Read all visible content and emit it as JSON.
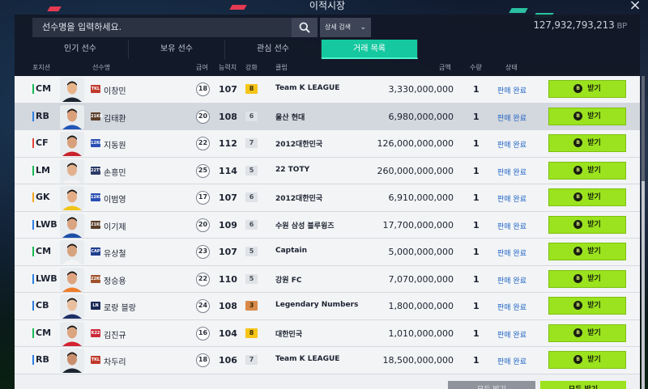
{
  "window": {
    "title": "이적시장",
    "close_icon": "×"
  },
  "search": {
    "placeholder": "선수명을 입력하세요.",
    "detail_label": "상세 검색"
  },
  "bp": {
    "amount": "127,932,793,213",
    "unit": "BP"
  },
  "tabs": [
    {
      "label": "인기 선수",
      "active": false
    },
    {
      "label": "보유 선수",
      "active": false
    },
    {
      "label": "관심 선수",
      "active": false
    },
    {
      "label": "거래 목록",
      "active": true
    }
  ],
  "columns": {
    "position": "포지션",
    "name": "선수명",
    "grade": "급여",
    "ovr": "능력치",
    "level": "강화",
    "club": "클럽",
    "price": "금액",
    "qty": "수량",
    "status": "상태"
  },
  "rows": [
    {
      "pos": "CM",
      "pos_color": "#1bb954",
      "season": "TKL",
      "season_color": "#c0392b",
      "name": "이창민",
      "grade": "18",
      "ovr": "107",
      "lvl": "8",
      "lvl_color": "#f5c518",
      "club": "Team K LEAGUE",
      "price": "3,330,000,000",
      "qty": "1",
      "status": "판매 완료",
      "btn": "받기",
      "skin": "#e7b48a",
      "kit": "#1b2430",
      "highlight": false
    },
    {
      "pos": "RB",
      "pos_color": "#2f7fe0",
      "season": "21KB",
      "season_color": "#5b3e2a",
      "name": "김태환",
      "grade": "20",
      "ovr": "108",
      "lvl": "6",
      "lvl_color": "#dfe2e6",
      "club": "울산 현대",
      "price": "6,980,000,000",
      "qty": "1",
      "status": "판매 완료",
      "btn": "받기",
      "skin": "#d9a07a",
      "kit": "#2456b8",
      "highlight": true
    },
    {
      "pos": "CF",
      "pos_color": "#e4473c",
      "season": "12KH",
      "season_color": "#2a4fb3",
      "name": "지동원",
      "grade": "22",
      "ovr": "112",
      "lvl": "7",
      "lvl_color": "#dfe2e6",
      "club": "2012대한민국",
      "price": "126,000,000,000",
      "qty": "1",
      "status": "판매 완료",
      "btn": "받기",
      "skin": "#d8a07c",
      "kit": "#c9222d",
      "highlight": false
    },
    {
      "pos": "LM",
      "pos_color": "#1bb954",
      "season": "22TY",
      "season_color": "#2b3a66",
      "name": "손흥민",
      "grade": "25",
      "ovr": "114",
      "lvl": "5",
      "lvl_color": "#dfe2e6",
      "club": "22 TOTY",
      "price": "260,000,000,000",
      "qty": "1",
      "status": "판매 완료",
      "btn": "받기",
      "skin": "#e2b08c",
      "kit": "#f2f2f2",
      "highlight": false
    },
    {
      "pos": "GK",
      "pos_color": "#f5a623",
      "season": "12KH",
      "season_color": "#2a4fb3",
      "name": "이범영",
      "grade": "17",
      "ovr": "107",
      "lvl": "6",
      "lvl_color": "#dfe2e6",
      "club": "2012대한민국",
      "price": "6,910,000,000",
      "qty": "1",
      "status": "판매 완료",
      "btn": "받기",
      "skin": "#e4ad86",
      "kit": "#f0c419",
      "highlight": false
    },
    {
      "pos": "LWB",
      "pos_color": "#2f7fe0",
      "season": "21KB",
      "season_color": "#5b3e2a",
      "name": "이기제",
      "grade": "20",
      "ovr": "109",
      "lvl": "6",
      "lvl_color": "#dfe2e6",
      "club": "수원 삼성 블루윙즈",
      "price": "17,700,000,000",
      "qty": "1",
      "status": "판매 완료",
      "btn": "받기",
      "skin": "#d9a581",
      "kit": "#1d4fa8",
      "highlight": false
    },
    {
      "pos": "CM",
      "pos_color": "#1bb954",
      "season": "CAP",
      "season_color": "#1f3f8f",
      "name": "유상철",
      "grade": "23",
      "ovr": "107",
      "lvl": "5",
      "lvl_color": "#dfe2e6",
      "club": "Captain",
      "price": "5,000,000,000",
      "qty": "1",
      "status": "판매 완료",
      "btn": "받기",
      "skin": "#d7a27e",
      "kit": "#f4f4f4",
      "highlight": false
    },
    {
      "pos": "LWB",
      "pos_color": "#2f7fe0",
      "season": "22KB",
      "season_color": "#a0522d",
      "name": "정승용",
      "grade": "22",
      "ovr": "110",
      "lvl": "5",
      "lvl_color": "#dfe2e6",
      "club": "강원 FC",
      "price": "7,070,000,000",
      "qty": "1",
      "status": "판매 완료",
      "btn": "받기",
      "skin": "#dea37f",
      "kit": "#f07d2b",
      "highlight": false
    },
    {
      "pos": "CB",
      "pos_color": "#2f7fe0",
      "season": "LN",
      "season_color": "#1a2a55",
      "name": "로랑 블랑",
      "grade": "24",
      "ovr": "108",
      "lvl": "3",
      "lvl_color": "#d98a4a",
      "club": "Legendary Numbers",
      "price": "1,800,000,000",
      "qty": "1",
      "status": "판매 완료",
      "btn": "받기",
      "skin": "#e8c0a0",
      "kit": "#1c2f66",
      "highlight": false
    },
    {
      "pos": "CM",
      "pos_color": "#1bb954",
      "season": "K22",
      "season_color": "#cc2a3a",
      "name": "김진규",
      "grade": "16",
      "ovr": "104",
      "lvl": "8",
      "lvl_color": "#f5c518",
      "club": "대한민국",
      "price": "1,010,000,000",
      "qty": "1",
      "status": "판매 완료",
      "btn": "받기",
      "skin": "#dba580",
      "kit": "#d3232f",
      "highlight": false
    },
    {
      "pos": "RB",
      "pos_color": "#2f7fe0",
      "season": "TKL",
      "season_color": "#c0392b",
      "name": "차두리",
      "grade": "18",
      "ovr": "106",
      "lvl": "7",
      "lvl_color": "#dfe2e6",
      "club": "Team K LEAGUE",
      "price": "18,500,000,000",
      "qty": "1",
      "status": "판매 완료",
      "btn": "받기",
      "skin": "#c98f6d",
      "kit": "#1b2430",
      "highlight": false
    }
  ],
  "footer": {
    "receive_all_gray": "모두 받기",
    "receive_all_green": "모두 받기"
  }
}
